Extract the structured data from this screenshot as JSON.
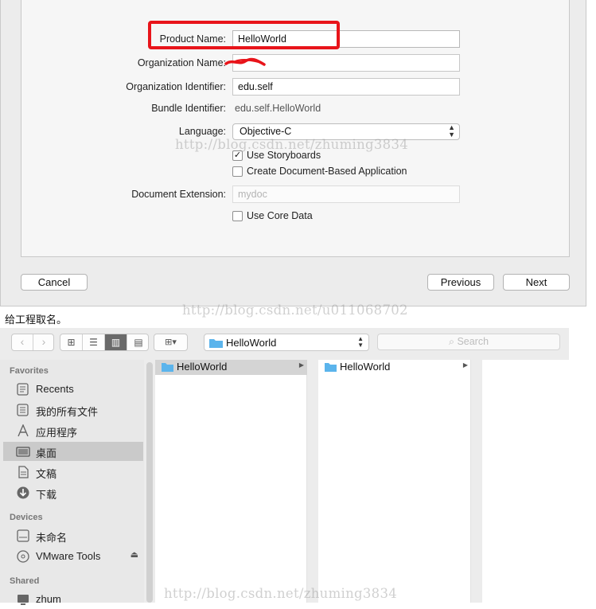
{
  "form": {
    "product_name_label": "Product Name:",
    "product_name_value": "HelloWorld",
    "org_name_label": "Organization Name:",
    "org_name_value": "",
    "org_id_label": "Organization Identifier:",
    "org_id_value": "edu.self",
    "bundle_id_label": "Bundle Identifier:",
    "bundle_id_value": "edu.self.HelloWorld",
    "language_label": "Language:",
    "language_value": "Objective-C",
    "use_storyboards_label": "Use Storyboards",
    "use_storyboards_checked": true,
    "doc_based_label": "Create Document-Based Application",
    "doc_based_checked": false,
    "doc_ext_label": "Document Extension:",
    "doc_ext_placeholder": "mydoc",
    "core_data_label": "Use Core Data",
    "core_data_checked": false
  },
  "buttons": {
    "cancel": "Cancel",
    "previous": "Previous",
    "next": "Next"
  },
  "watermarks": {
    "w1": "http://blog.csdn.net/zhuming3834",
    "w2": "http://blog.csdn.net/u011068702",
    "w3": "http://blog.csdn.net/zhuming3834"
  },
  "caption": "给工程取名。",
  "finder": {
    "location": "HelloWorld",
    "search_placeholder": "Search",
    "sidebar": {
      "favorites_header": "Favorites",
      "favorites": [
        {
          "label": "Recents",
          "icon": "recents-icon"
        },
        {
          "label": "我的所有文件",
          "icon": "all-files-icon"
        },
        {
          "label": "应用程序",
          "icon": "applications-icon"
        },
        {
          "label": "桌面",
          "icon": "desktop-icon",
          "selected": true
        },
        {
          "label": "文稿",
          "icon": "documents-icon"
        },
        {
          "label": "下载",
          "icon": "downloads-icon"
        }
      ],
      "devices_header": "Devices",
      "devices": [
        {
          "label": "未命名",
          "icon": "disk-icon"
        },
        {
          "label": "VMware Tools",
          "icon": "cd-icon"
        }
      ],
      "shared_header": "Shared",
      "shared": [
        {
          "label": "zhum",
          "icon": "computer-icon"
        }
      ]
    },
    "columns": [
      {
        "items": [
          "HelloWorld"
        ]
      },
      {
        "items": [
          "HelloWorld"
        ]
      }
    ]
  },
  "colors": {
    "highlight": "#e8141a",
    "folder": "#5bb4ec"
  }
}
